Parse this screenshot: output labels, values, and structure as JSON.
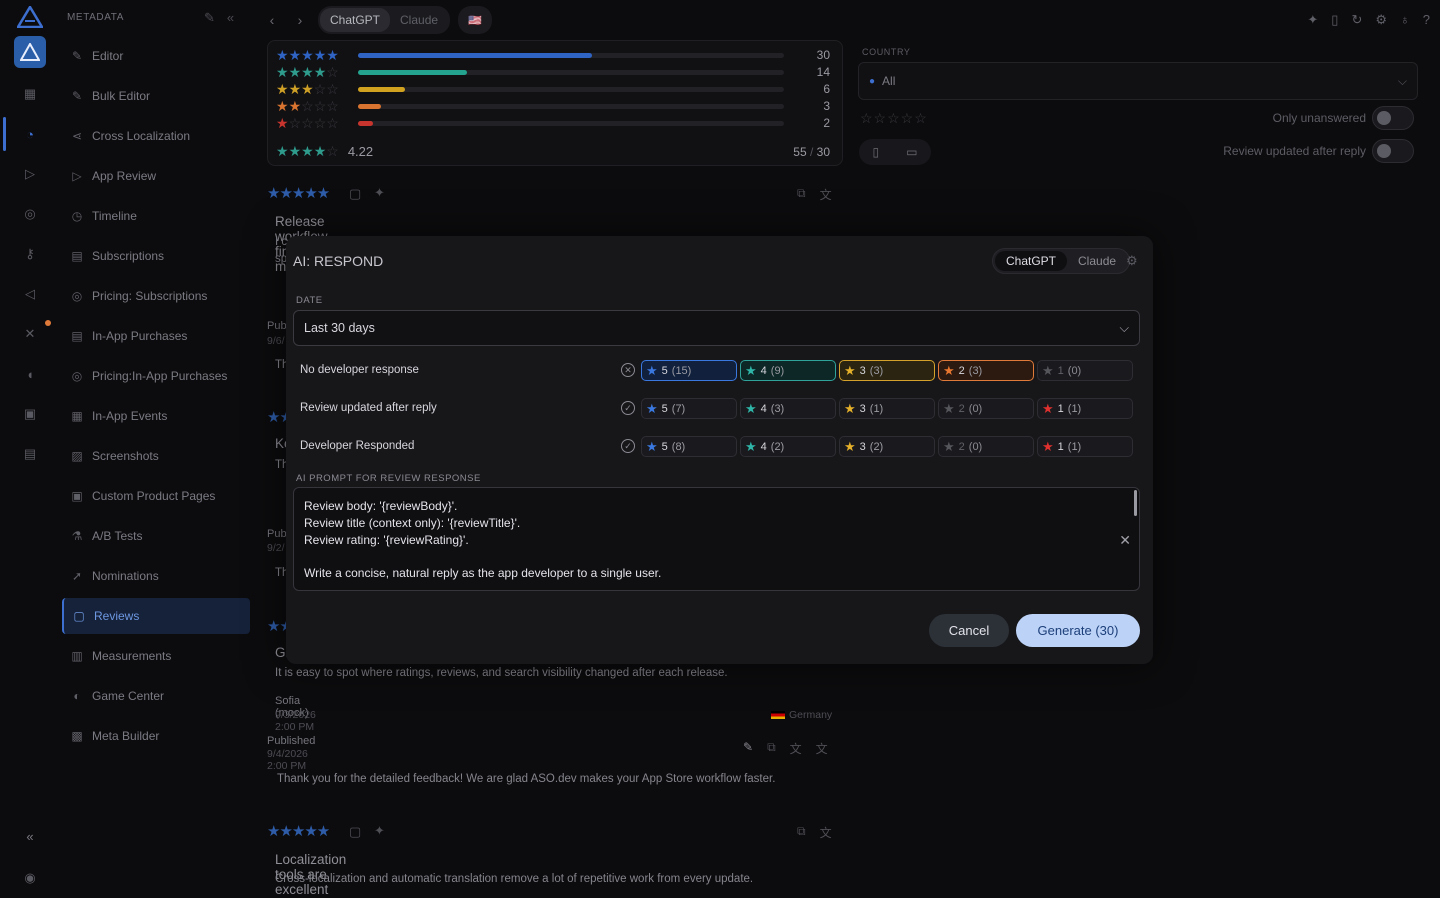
{
  "sidebar": {
    "title": "METADATA",
    "items": [
      {
        "label": "Editor",
        "icon": "pencil-icon"
      },
      {
        "label": "Bulk Editor",
        "icon": "bulk-edit-icon"
      },
      {
        "label": "Cross Localization",
        "icon": "share-icon"
      },
      {
        "label": "App Review",
        "icon": "send-icon"
      },
      {
        "label": "Timeline",
        "icon": "history-icon"
      },
      {
        "label": "Subscriptions",
        "icon": "document-icon"
      },
      {
        "label": "Pricing: Subscriptions",
        "icon": "coin-icon"
      },
      {
        "label": "In-App Purchases",
        "icon": "document-icon"
      },
      {
        "label": "Pricing:In-App Purchases",
        "icon": "coin-icon"
      },
      {
        "label": "In-App Events",
        "icon": "calendar-icon"
      },
      {
        "label": "Screenshots",
        "icon": "image-icon"
      },
      {
        "label": "Custom Product Pages",
        "icon": "pages-icon"
      },
      {
        "label": "A/B Tests",
        "icon": "flask-icon"
      },
      {
        "label": "Nominations",
        "icon": "rocket-icon"
      },
      {
        "label": "Reviews",
        "icon": "reviews-icon",
        "active": true
      },
      {
        "label": "Measurements",
        "icon": "chart-icon"
      },
      {
        "label": "Game Center",
        "icon": "gamepad-icon"
      },
      {
        "label": "Meta Builder",
        "icon": "builder-icon"
      }
    ]
  },
  "topbar": {
    "ai_tabs": [
      "ChatGPT",
      "Claude"
    ],
    "ai_tab_active": "ChatGPT",
    "flag": "🇺🇸"
  },
  "ratings": {
    "rows": [
      {
        "stars": 5,
        "count": "30",
        "fraction": 0.55,
        "color": "#2f63c4"
      },
      {
        "stars": 4,
        "count": "14",
        "fraction": 0.255,
        "color": "#24a38f"
      },
      {
        "stars": 3,
        "count": "6",
        "fraction": 0.11,
        "color": "#d1a21f"
      },
      {
        "stars": 2,
        "count": "3",
        "fraction": 0.055,
        "color": "#d8742f"
      },
      {
        "stars": 1,
        "count": "2",
        "fraction": 0.036,
        "color": "#c8352e"
      }
    ],
    "average": "4.22",
    "average_stars": 4,
    "ratio_current": "55",
    "ratio_sep": " / ",
    "ratio_total": "30"
  },
  "filters": {
    "country_label": "COUNTRY",
    "country_value": "All",
    "only_unanswered_label": "Only unanswered",
    "updated_after_reply_label": "Review updated after reply"
  },
  "reviews": [
    {
      "title": "Release workflow finally feels manageable",
      "body_fragment": "I c",
      "body_fragment2": "sp",
      "published_fragment": "Pub",
      "date_fragment": "9/6/",
      "reply_fragment": "Th"
    },
    {
      "title_fragment": "Ke",
      "body_fragment": "Th",
      "published_fragment": "Pub",
      "date_fragment": "9/2/",
      "reply_fragment": "Th"
    },
    {
      "title_fragment": "Gi",
      "body": "It is easy to spot where ratings, reviews, and search visibility changed after each release.",
      "author": "Sofia (mock)",
      "date": "9/3/2026 2:00 PM",
      "country": "Germany",
      "published_label": "Published",
      "published_date": "9/4/2026 2:00 PM",
      "reply": "Thank you for the detailed feedback! We are glad ASO.dev makes your App Store workflow faster."
    },
    {
      "title": "Localization tools are excellent",
      "body": "Cross-localization and automatic translation remove a lot of repetitive work from every update."
    }
  ],
  "modal": {
    "title": "AI: RESPOND",
    "ai_tabs": [
      "ChatGPT",
      "Claude"
    ],
    "date_label": "DATE",
    "date_value": "Last 30 days",
    "filter_rows": [
      {
        "label": "No developer response",
        "pills": [
          {
            "stars": "5",
            "count": "(15)",
            "color": "#3a78e0",
            "selected": "sel-blue"
          },
          {
            "stars": "4",
            "count": "(9)",
            "color": "#2fb6a8",
            "selected": "sel-teal"
          },
          {
            "stars": "3",
            "count": "(3)",
            "color": "#e5b02a",
            "selected": "sel-yellow"
          },
          {
            "stars": "2",
            "count": "(3)",
            "color": "#e9772f",
            "selected": "sel-orange"
          },
          {
            "stars": "1",
            "count": "(0)",
            "color": "#55555c",
            "selected": "dim"
          }
        ]
      },
      {
        "label": "Review updated after reply",
        "pills": [
          {
            "stars": "5",
            "count": "(7)",
            "color": "#3a78e0",
            "selected": ""
          },
          {
            "stars": "4",
            "count": "(3)",
            "color": "#2fb6a8",
            "selected": ""
          },
          {
            "stars": "3",
            "count": "(1)",
            "color": "#e5b02a",
            "selected": ""
          },
          {
            "stars": "2",
            "count": "(0)",
            "color": "#55555c",
            "selected": "dim"
          },
          {
            "stars": "1",
            "count": "(1)",
            "color": "#e0312f",
            "selected": ""
          }
        ]
      },
      {
        "label": "Developer Responded",
        "pills": [
          {
            "stars": "5",
            "count": "(8)",
            "color": "#3a78e0",
            "selected": ""
          },
          {
            "stars": "4",
            "count": "(2)",
            "color": "#2fb6a8",
            "selected": ""
          },
          {
            "stars": "3",
            "count": "(2)",
            "color": "#e5b02a",
            "selected": ""
          },
          {
            "stars": "2",
            "count": "(0)",
            "color": "#55555c",
            "selected": "dim"
          },
          {
            "stars": "1",
            "count": "(1)",
            "color": "#e0312f",
            "selected": ""
          }
        ]
      }
    ],
    "prompt_label": "AI PROMPT FOR REVIEW RESPONSE",
    "prompt_lines": [
      "Review body: '{reviewBody}'.",
      "Review title (context only): '{reviewTitle}'.",
      "Review rating: '{reviewRating}'.",
      "",
      "Write a concise, natural reply as the app developer to a single user."
    ],
    "cancel_label": "Cancel",
    "generate_label": "Generate (30)"
  }
}
